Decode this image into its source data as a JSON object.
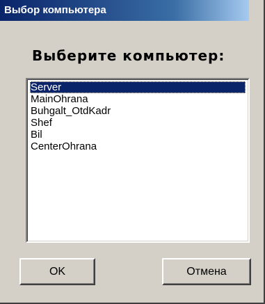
{
  "window": {
    "title": "Выбор компьютера"
  },
  "dialog": {
    "heading": "Выберите компьютер:",
    "computers": [
      {
        "label": "Server",
        "selected": true
      },
      {
        "label": "MainOhrana",
        "selected": false
      },
      {
        "label": "Buhgalt_OtdKadr",
        "selected": false
      },
      {
        "label": "Shef",
        "selected": false
      },
      {
        "label": "Bil",
        "selected": false
      },
      {
        "label": "CenterOhrana",
        "selected": false
      }
    ],
    "ok_label": "OK",
    "cancel_label": "Отмена"
  },
  "colors": {
    "title_bar": "#0a246a",
    "face": "#d4d0c8",
    "selection": "#0a246a"
  }
}
